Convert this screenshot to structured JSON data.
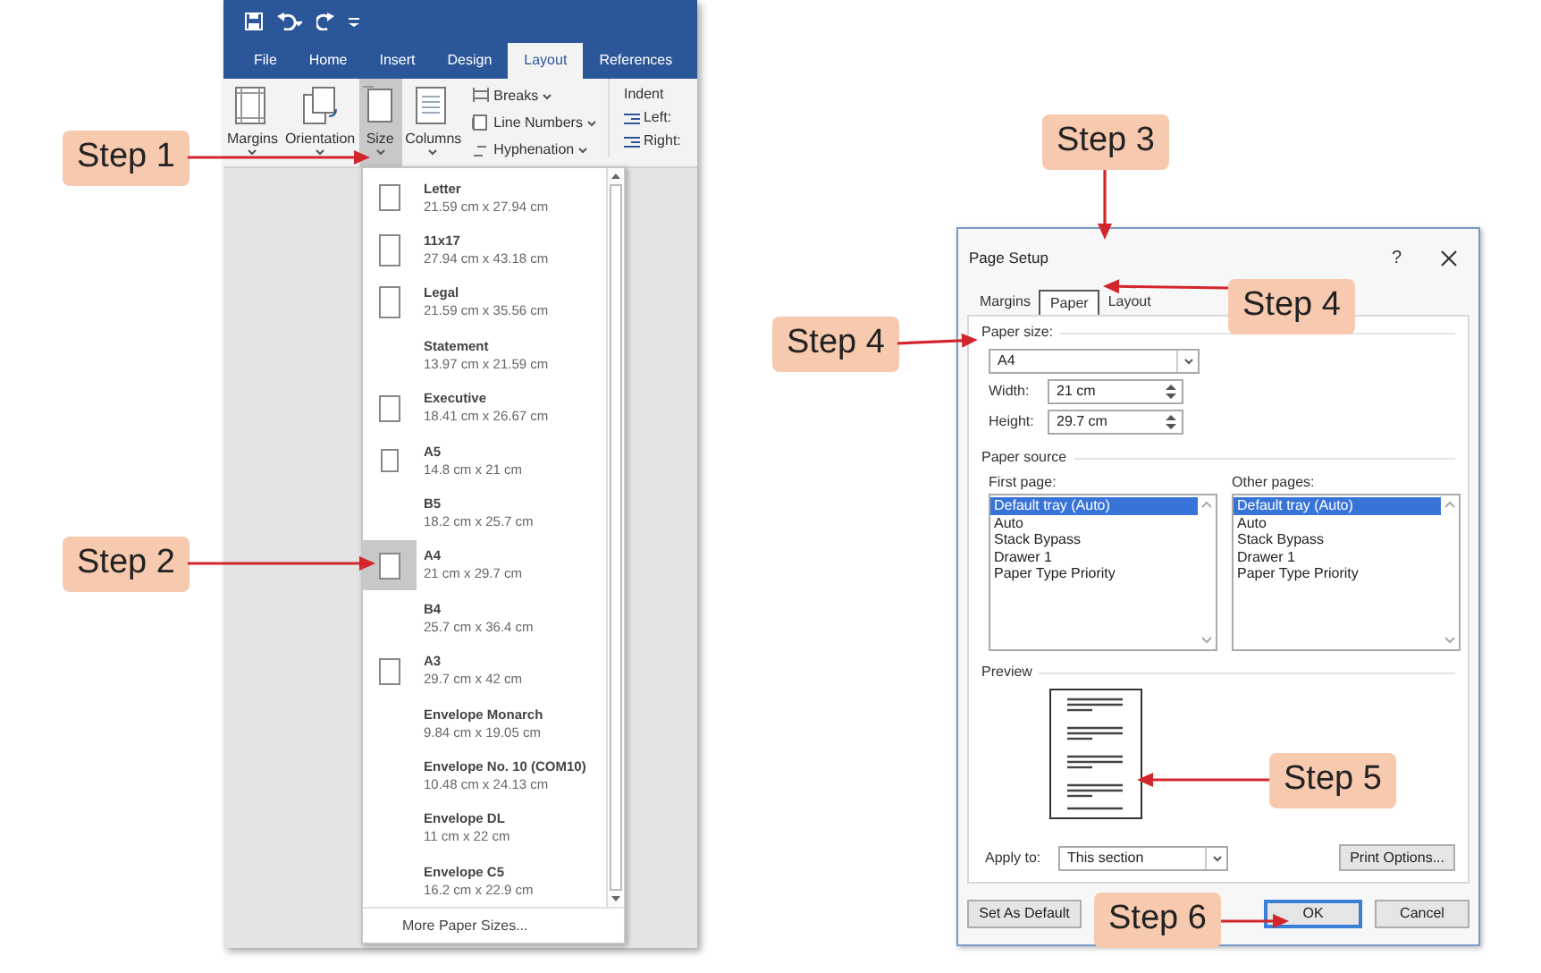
{
  "word_window": {
    "tabs": [
      {
        "label": "File",
        "selected": false
      },
      {
        "label": "Home",
        "selected": false
      },
      {
        "label": "Insert",
        "selected": false
      },
      {
        "label": "Design",
        "selected": false
      },
      {
        "label": "Layout",
        "selected": true
      },
      {
        "label": "References",
        "selected": false
      }
    ],
    "ribbon": {
      "large_buttons": [
        {
          "label": "Margins",
          "pressed": false
        },
        {
          "label": "Orientation",
          "pressed": false
        },
        {
          "label": "Size",
          "pressed": true
        },
        {
          "label": "Columns",
          "pressed": false
        }
      ],
      "small_buttons": [
        "Breaks",
        "Line Numbers",
        "Hyphenation"
      ],
      "indent": {
        "title": "Indent",
        "labels": [
          "Left:",
          "Right:"
        ]
      }
    },
    "size_menu": {
      "items": [
        {
          "name": "Letter",
          "size": "21.59 cm x 27.94 cm",
          "kind": "page",
          "selected": false
        },
        {
          "name": "11x17",
          "size": "27.94 cm x 43.18 cm",
          "kind": "page",
          "selected": false
        },
        {
          "name": "Legal",
          "size": "21.59 cm x 35.56 cm",
          "kind": "page",
          "selected": false
        },
        {
          "name": "Statement",
          "size": "13.97 cm x 21.59 cm",
          "kind": "plain",
          "selected": false
        },
        {
          "name": "Executive",
          "size": "18.41 cm x 26.67 cm",
          "kind": "page",
          "selected": false
        },
        {
          "name": "A5",
          "size": "14.8 cm x 21 cm",
          "kind": "page",
          "selected": false
        },
        {
          "name": "B5",
          "size": "18.2 cm x 25.7 cm",
          "kind": "plain",
          "selected": false
        },
        {
          "name": "A4",
          "size": "21 cm x 29.7 cm",
          "kind": "page",
          "selected": true
        },
        {
          "name": "B4",
          "size": "25.7 cm x 36.4 cm",
          "kind": "plain",
          "selected": false
        },
        {
          "name": "A3",
          "size": "29.7 cm x 42 cm",
          "kind": "page",
          "selected": false
        },
        {
          "name": "Envelope Monarch",
          "size": "9.84 cm x 19.05 cm",
          "kind": "plain",
          "selected": false
        },
        {
          "name": "Envelope No. 10 (COM10)",
          "size": "10.48 cm x 24.13 cm",
          "kind": "plain",
          "selected": false
        },
        {
          "name": "Envelope DL",
          "size": "11 cm x 22 cm",
          "kind": "plain",
          "selected": false
        },
        {
          "name": "Envelope C5",
          "size": "16.2 cm x 22.9 cm",
          "kind": "plain",
          "selected": false
        }
      ],
      "footer": "More Paper Sizes..."
    }
  },
  "page_setup": {
    "title": "Page Setup",
    "help": "?",
    "tabs": [
      {
        "label": "Margins",
        "selected": false
      },
      {
        "label": "Paper",
        "selected": true
      },
      {
        "label": "Layout",
        "selected": false
      }
    ],
    "paper_size": {
      "label": "Paper size:",
      "value": "A4"
    },
    "width": {
      "label": "Width:",
      "value": "21 cm"
    },
    "height": {
      "label": "Height:",
      "value": "29.7 cm"
    },
    "paper_source": {
      "label": "Paper source",
      "lists": [
        {
          "label": "First page:",
          "items": [
            {
              "text": "Default tray (Auto)",
              "selected": true
            },
            {
              "text": "Auto",
              "selected": false
            },
            {
              "text": "Stack Bypass",
              "selected": false
            },
            {
              "text": "Drawer 1",
              "selected": false
            },
            {
              "text": "Paper Type Priority",
              "selected": false
            }
          ]
        },
        {
          "label": "Other pages:",
          "items": [
            {
              "text": "Default tray (Auto)",
              "selected": true
            },
            {
              "text": "Auto",
              "selected": false
            },
            {
              "text": "Stack Bypass",
              "selected": false
            },
            {
              "text": "Drawer 1",
              "selected": false
            },
            {
              "text": "Paper Type Priority",
              "selected": false
            }
          ]
        }
      ]
    },
    "preview_label": "Preview",
    "apply_to": {
      "label": "Apply to:",
      "value": "This section"
    },
    "print_options": "Print Options...",
    "buttons": [
      {
        "label": "Set As Default",
        "default": false
      },
      {
        "label": "OK",
        "default": true
      },
      {
        "label": "Cancel",
        "default": false
      }
    ]
  },
  "callouts": [
    {
      "label": "Step 1"
    },
    {
      "label": "Step 2"
    },
    {
      "label": "Step 3"
    },
    {
      "label": "Step 4"
    },
    {
      "label": "Step 4"
    },
    {
      "label": "Step 5"
    },
    {
      "label": "Step 6"
    }
  ]
}
